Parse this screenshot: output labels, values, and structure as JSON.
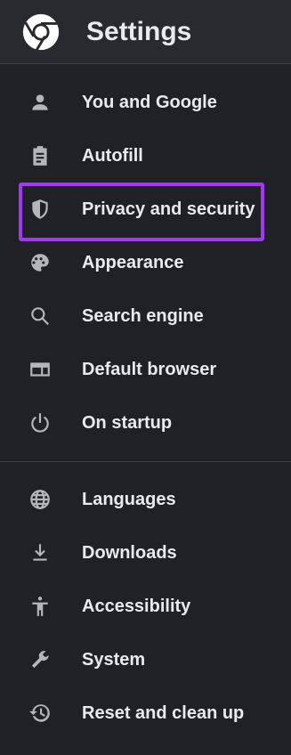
{
  "header": {
    "title": "Settings",
    "logo_icon": "chrome-logo-icon"
  },
  "highlight_color": "#a238f5",
  "nav": {
    "items": [
      {
        "label": "You and Google",
        "icon": "person-icon"
      },
      {
        "label": "Autofill",
        "icon": "clipboard-icon"
      },
      {
        "label": "Privacy and security",
        "icon": "shield-icon",
        "highlighted": true
      },
      {
        "label": "Appearance",
        "icon": "palette-icon"
      },
      {
        "label": "Search engine",
        "icon": "search-icon"
      },
      {
        "label": "Default browser",
        "icon": "browser-window-icon"
      },
      {
        "label": "On startup",
        "icon": "power-icon"
      },
      {
        "label": "Languages",
        "icon": "globe-icon"
      },
      {
        "label": "Downloads",
        "icon": "download-icon"
      },
      {
        "label": "Accessibility",
        "icon": "accessibility-icon"
      },
      {
        "label": "System",
        "icon": "wrench-icon"
      },
      {
        "label": "Reset and clean up",
        "icon": "reset-history-icon"
      }
    ]
  }
}
